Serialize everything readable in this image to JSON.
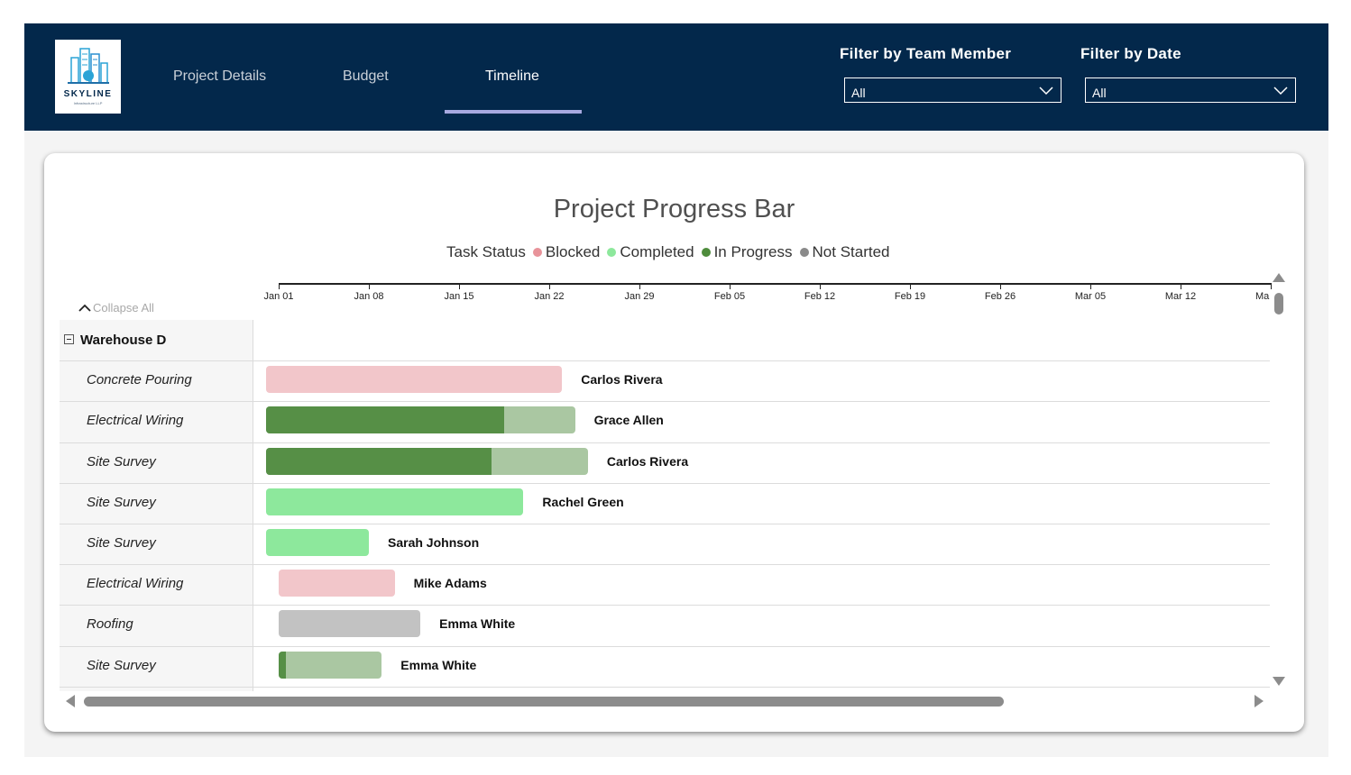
{
  "header": {
    "logo": {
      "brand": "SKYLINE",
      "subtitle": "Infrastructure LLP"
    },
    "tabs": [
      {
        "label": "Project Details",
        "active": false
      },
      {
        "label": "Budget",
        "active": false
      },
      {
        "label": "Timeline",
        "active": true
      }
    ],
    "filters": {
      "team_member": {
        "label": "Filter by Team Member",
        "value": "All"
      },
      "date": {
        "label": "Filter by Date",
        "value": "All"
      }
    }
  },
  "chart": {
    "title": "Project Progress Bar",
    "legend_title": "Task Status",
    "legend": [
      {
        "label": "Blocked",
        "color": "#e8939a"
      },
      {
        "label": "Completed",
        "color": "#8de89c"
      },
      {
        "label": "In Progress",
        "color": "#4e8c3c"
      },
      {
        "label": "Not Started",
        "color": "#8a8a8a"
      }
    ],
    "collapse_label": "Collapse All",
    "axis_ticks": [
      "Jan 01",
      "Jan 08",
      "Jan 15",
      "Jan 22",
      "Jan 29",
      "Feb 05",
      "Feb 12",
      "Feb 19",
      "Feb 26",
      "Mar 05",
      "Mar 12",
      "Ma"
    ],
    "group": "Warehouse D"
  },
  "chart_data": {
    "type": "gantt",
    "title": "Project Progress Bar",
    "x_axis": "date",
    "xlim": [
      "Jan 01",
      "Mar 19"
    ],
    "group": "Warehouse D",
    "tasks": [
      {
        "task": "Concrete Pouring",
        "assignee": "Carlos Rivera",
        "status": "Blocked",
        "start": "Dec 31",
        "end": "Jan 23",
        "progress": 0
      },
      {
        "task": "Electrical Wiring",
        "assignee": "Grace Allen",
        "status": "In Progress",
        "start": "Dec 31",
        "end": "Jan 24",
        "progress": 0.77
      },
      {
        "task": "Site Survey",
        "assignee": "Carlos Rivera",
        "status": "In Progress",
        "start": "Dec 31",
        "end": "Jan 25",
        "progress": 0.7
      },
      {
        "task": "Site Survey",
        "assignee": "Rachel Green",
        "status": "Completed",
        "start": "Dec 31",
        "end": "Jan 20",
        "progress": 1
      },
      {
        "task": "Site Survey",
        "assignee": "Sarah Johnson",
        "status": "Completed",
        "start": "Dec 31",
        "end": "Jan 08",
        "progress": 1
      },
      {
        "task": "Electrical Wiring",
        "assignee": "Mike Adams",
        "status": "Blocked",
        "start": "Jan 01",
        "end": "Jan 10",
        "progress": 0
      },
      {
        "task": "Roofing",
        "assignee": "Emma White",
        "status": "Not Started",
        "start": "Jan 01",
        "end": "Jan 12",
        "progress": 0
      },
      {
        "task": "Site Survey",
        "assignee": "Emma White",
        "status": "In Progress",
        "start": "Jan 01",
        "end": "Jan 09",
        "progress": 0.07
      }
    ]
  }
}
